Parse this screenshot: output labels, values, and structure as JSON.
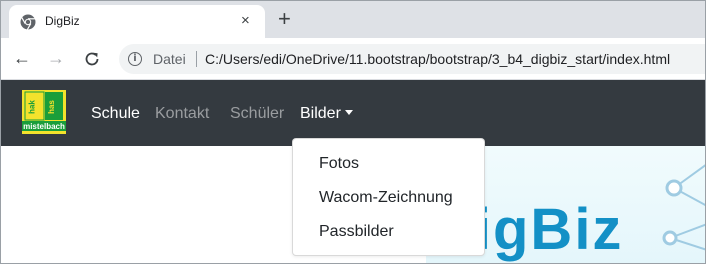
{
  "browser": {
    "tab": {
      "title": "DigBiz",
      "close_glyph": "×"
    },
    "new_tab_glyph": "+",
    "nav": {
      "back_glyph": "←",
      "forward_glyph": "→",
      "reload_glyph": "C"
    },
    "address": {
      "info_glyph": "i",
      "scheme_label": "Datei",
      "url": "C:/Users/edi/OneDrive/11.bootstrap/bootstrap/3_b4_digbiz_start/index.html"
    }
  },
  "navbar": {
    "brand": {
      "logo_text_left": "hak",
      "logo_text_right": "has",
      "logo_text_bottom": "mistelbach"
    },
    "links": [
      {
        "label": "Schule",
        "state": "active"
      },
      {
        "label": "Kontakt",
        "state": "muted"
      },
      {
        "label": "Schüler",
        "state": "muted"
      },
      {
        "label": "Bilder",
        "state": "active",
        "dropdown": true
      }
    ]
  },
  "dropdown": {
    "items": [
      "Fotos",
      "Wacom-Zeichnung",
      "Passbilder"
    ]
  },
  "hero": {
    "text": "DigBiz"
  },
  "colors": {
    "navbar_bg": "#343a40",
    "link_active": "#ffffff",
    "link_muted": "#9a9da0",
    "hero_text": "#1390c6",
    "logo_green": "#1a9e3a",
    "logo_yellow": "#f3e22c"
  },
  "icons": [
    "chrome-favicon-icon",
    "close-icon",
    "plus-icon",
    "back-arrow-icon",
    "forward-arrow-icon",
    "reload-icon",
    "info-icon",
    "caret-down-icon"
  ]
}
